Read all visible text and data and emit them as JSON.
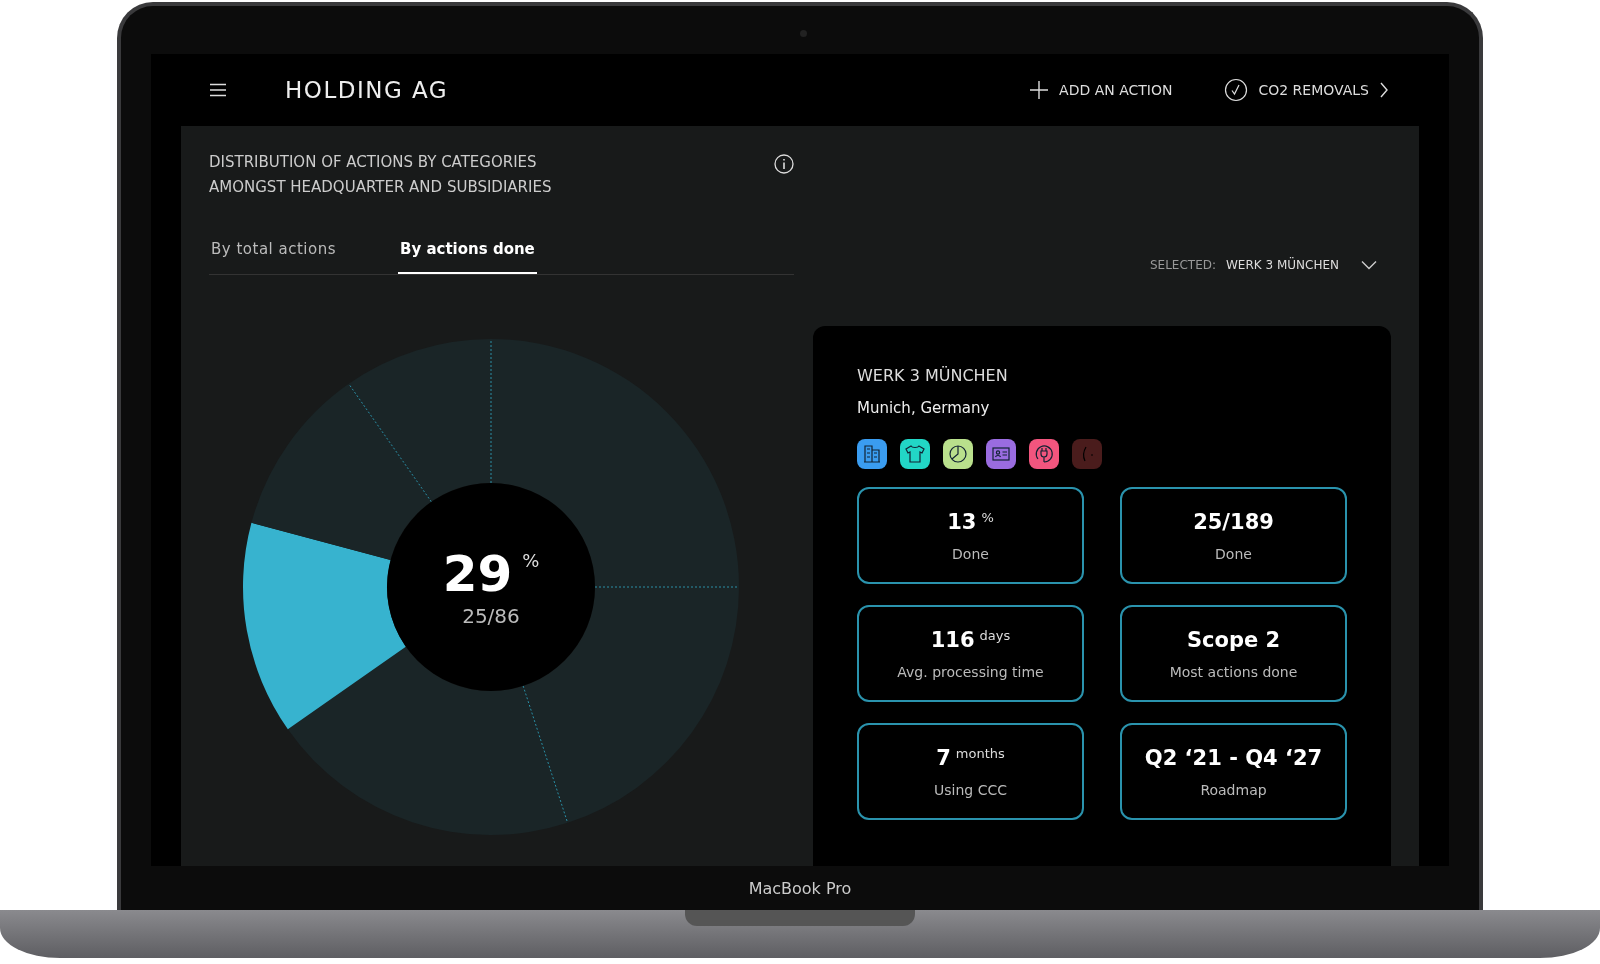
{
  "header": {
    "title": "HOLDING AG",
    "actions": [
      {
        "kind": "add",
        "label": "ADD AN ACTION"
      },
      {
        "kind": "check",
        "label": "CO2 REMOVALS"
      }
    ]
  },
  "panel": {
    "title": "DISTRIBUTION OF ACTIONS BY CATEGORIES AMONGST HEADQUARTER AND SUBSIDIARIES",
    "tabs": [
      {
        "label": "By total actions",
        "selected": false
      },
      {
        "label": "By actions done",
        "selected": true
      }
    ],
    "selector": {
      "label": "SELECTED:",
      "value": "WERK 3 MÜNCHEN"
    },
    "donut": {
      "value": "29",
      "unit": "%",
      "fraction": "25/86",
      "segments": [
        {
          "selected": false
        },
        {
          "selected": false
        },
        {
          "selected": false
        },
        {
          "selected": true
        },
        {
          "selected": false
        },
        {
          "selected": false
        }
      ]
    }
  },
  "detail": {
    "name": "WERK 3 MÜNCHEN",
    "location": "Munich, Germany",
    "categories": [
      {
        "kind": "building",
        "color": "#3a9cf0"
      },
      {
        "kind": "shirt",
        "color": "#22d6c6"
      },
      {
        "kind": "pie",
        "color": "#b9e08c"
      },
      {
        "kind": "card",
        "color": "#9a6ce0"
      },
      {
        "kind": "plug",
        "color": "#f2557e"
      },
      {
        "kind": "leaf",
        "color": "#4a1c1c"
      }
    ],
    "stats": [
      {
        "value": "13",
        "unit": "%",
        "label": "Done"
      },
      {
        "value": "25/189",
        "label": "Done"
      },
      {
        "value": "116",
        "unit": "days",
        "label": "Avg. processing time"
      },
      {
        "value": "Scope 2",
        "label": "Most actions done"
      },
      {
        "value": "7",
        "unit": "months",
        "label": "Using CCC"
      },
      {
        "value": "Q2 ‘21 - Q4 ‘27",
        "label": "Roadmap"
      }
    ]
  },
  "device_label": "MacBook Pro"
}
